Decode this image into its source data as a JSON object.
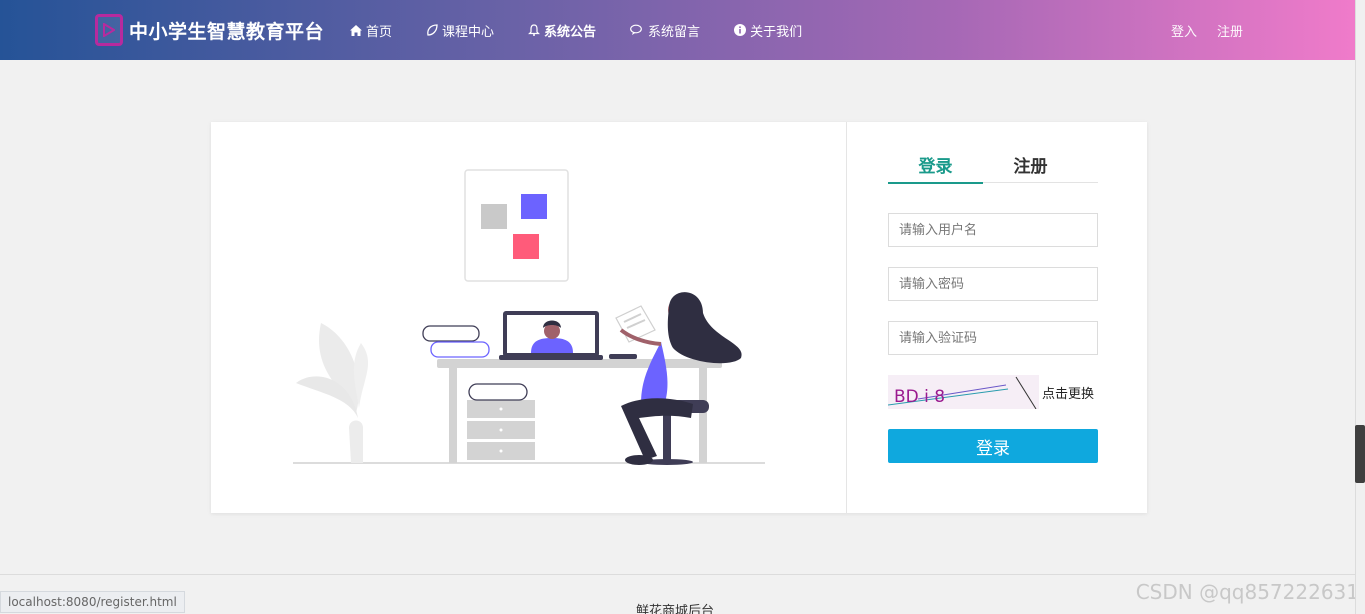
{
  "nav": {
    "brand": "中小学生智慧教育平台",
    "links": [
      {
        "label": "首页",
        "icon": "home-icon"
      },
      {
        "label": "课程中心",
        "icon": "leaf-icon"
      },
      {
        "label": "系统公告",
        "icon": "bell-icon"
      },
      {
        "label": "系统留言",
        "icon": "comments-icon"
      },
      {
        "label": "关于我们",
        "icon": "info-circle-icon"
      }
    ],
    "login": "登入",
    "register": "注册"
  },
  "form": {
    "tab_login": "登录",
    "tab_register": "注册",
    "username_placeholder": "请输入用户名",
    "password_placeholder": "请输入密码",
    "captcha_placeholder": "请输入验证码",
    "captcha_text": "BD i 8",
    "refresh_label": "点击更换",
    "submit_label": "登录"
  },
  "footer": {
    "text": "鲜花商城后台"
  },
  "status_url": "localhost:8080/register.html",
  "watermark": "CSDN @qq857222631",
  "colors": {
    "accent": "#1a9a8b",
    "button": "#0fa8de",
    "nav_start": "#255397",
    "nav_end": "#f07bca"
  }
}
